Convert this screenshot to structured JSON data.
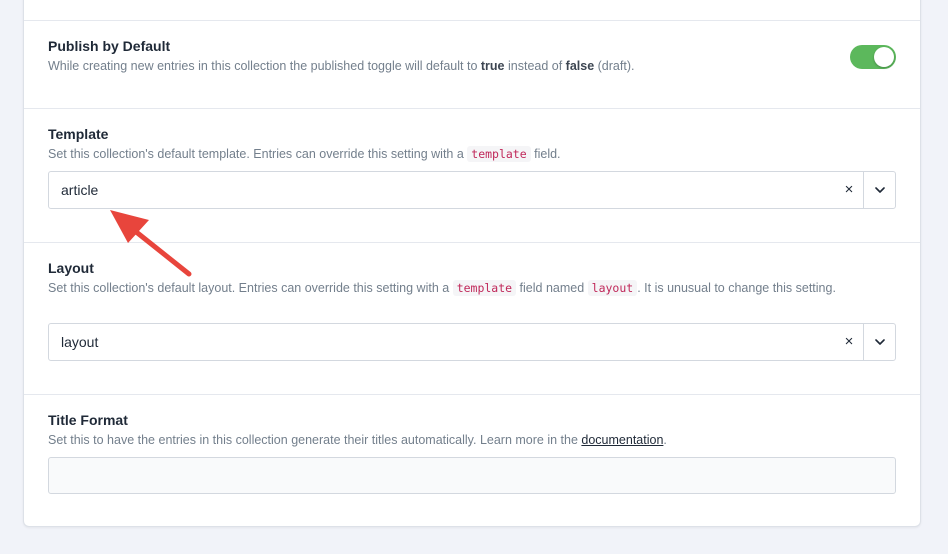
{
  "publish": {
    "label": "Publish by Default",
    "instr_pre": "While creating new entries in this collection the published toggle will default to ",
    "instr_true": "true",
    "instr_mid": " instead of ",
    "instr_false": "false",
    "instr_post": " (draft).",
    "enabled": true
  },
  "template": {
    "label": "Template",
    "instr_pre": "Set this collection's default template. Entries can override this setting with a ",
    "instr_code": "template",
    "instr_post": " field.",
    "value": "article",
    "clear": "×"
  },
  "layout": {
    "label": "Layout",
    "instr_pre": "Set this collection's default layout. Entries can override this setting with a ",
    "instr_code1": "template",
    "instr_mid": " field named ",
    "instr_code2": "layout",
    "instr_post": ". It is unusual to change this setting.",
    "value": "layout",
    "clear": "×"
  },
  "title_format": {
    "label": "Title Format",
    "instr_pre": "Set this to have the entries in this collection generate their titles automatically. Learn more in the ",
    "instr_link": "documentation",
    "instr_post": ".",
    "value": ""
  },
  "colors": {
    "toggle_on": "#5cb85c",
    "arrow": "#e8453c",
    "code_text": "#c0285a"
  }
}
